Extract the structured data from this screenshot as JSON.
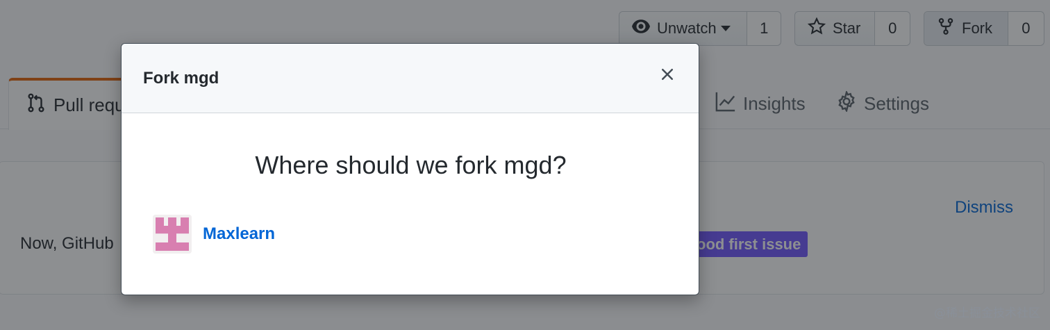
{
  "header": {
    "watch": {
      "label": "Unwatch",
      "count": "1",
      "icon": "eye-icon"
    },
    "star": {
      "label": "Star",
      "count": "0",
      "icon": "star-icon"
    },
    "fork": {
      "label": "Fork",
      "count": "0",
      "icon": "repo-forked-icon"
    }
  },
  "tabs": {
    "pull_requests": {
      "label": "Pull requ",
      "icon": "git-pull-request-icon"
    },
    "insights": {
      "label": "Insights",
      "icon": "graph-icon"
    },
    "settings": {
      "label": "Settings",
      "icon": "gear-icon"
    }
  },
  "banner": {
    "text": "Now, GitHub",
    "label": "ood first issue",
    "dismiss": "Dismiss"
  },
  "modal": {
    "title": "Fork mgd",
    "question": "Where should we fork mgd?",
    "targets": [
      {
        "name": "Maxlearn",
        "avatar": "identicon-avatar"
      }
    ],
    "close_icon": "x-icon"
  },
  "watermark": "@稀土掘金技术社区",
  "colors": {
    "accent_link": "#0366d6",
    "tab_highlight": "#e36209",
    "label_purple": "#7057ff",
    "identicon": "#d87fb0"
  }
}
